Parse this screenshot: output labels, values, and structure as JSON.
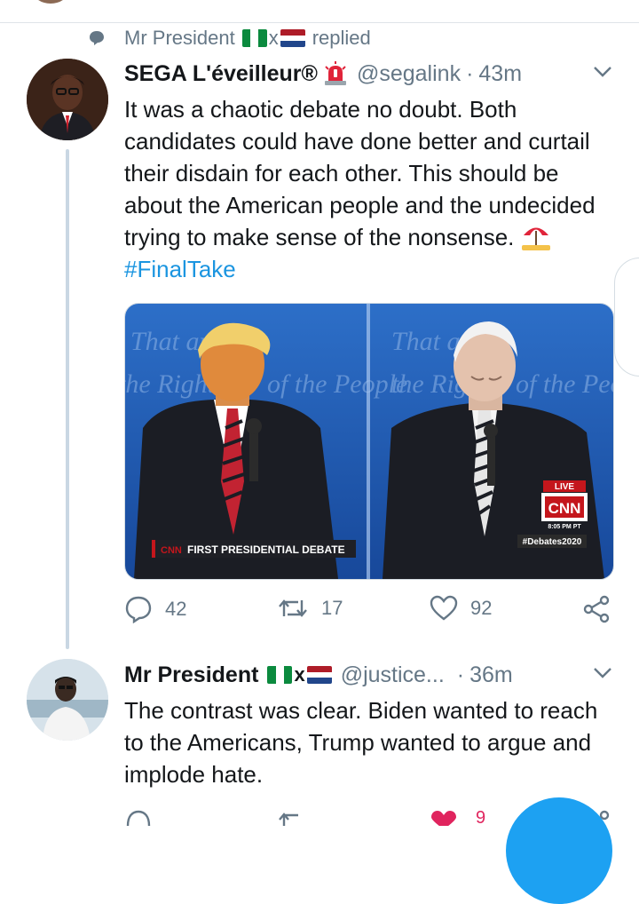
{
  "reply_context": {
    "icon": "speech-bubble-icon",
    "user": "Mr President",
    "flags": [
      "nigeria-flag",
      "netherlands-flag"
    ],
    "flag_separator": "x",
    "action": "replied"
  },
  "tweets": [
    {
      "name": "SEGA L'éveilleur®",
      "name_icon": "police-siren-icon",
      "handle": "@segalink",
      "dot": "·",
      "time": "43m",
      "text_main": "It was a chaotic debate no doubt. Both candidates could have done better and curtail their disdain for each other. This should be about the American people and the undecided trying to make sense of the nonsense.",
      "text_icon": "umbrella-on-ground-icon",
      "hashtag": "#FinalTake",
      "media": {
        "banner": "FIRST PRESIDENTIAL DEBATE",
        "network_logo": "CNN",
        "live_label": "LIVE",
        "timestamp": "8:05 PM PT",
        "debate_tag": "#Debates2020",
        "backdrop_text": "That any",
        "backdrop_text_2": "the Right",
        "backdrop_text_3": "of the People"
      },
      "actions": {
        "reply_count": "42",
        "retweet_count": "17",
        "like_count": "92"
      }
    },
    {
      "name": "Mr President",
      "name_flags": [
        "nigeria-flag",
        "netherlands-flag"
      ],
      "flag_separator": "x",
      "handle": "@justice...",
      "dot": "·",
      "time": "36m",
      "text_main": "The contrast was clear. Biden wanted to reach to the Americans, Trump wanted to argue and implode hate.",
      "actions": {
        "like_count": "9"
      }
    }
  ],
  "colors": {
    "accent": "#1da1f2",
    "secondary_text": "#657786",
    "hashtag": "#1b95e0",
    "like_red": "#e0245e",
    "thread_line": "#c9d7e3"
  }
}
